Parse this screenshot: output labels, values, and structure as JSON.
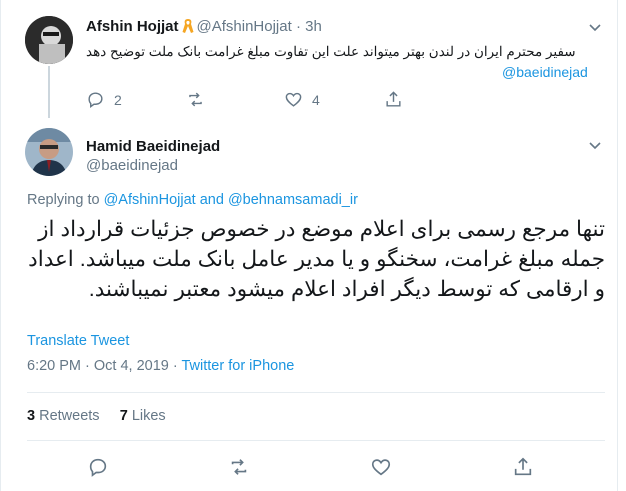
{
  "parent_tweet": {
    "author_name": "Afshin Hojjat",
    "author_handle": "@AfshinHojjat",
    "separator": "·",
    "time": "3h",
    "text": "سفیر محترم ایران در لندن بهتر میتواند علت این تفاوت مبلغ غرامت بانک ملت توضیح دهد",
    "mention": "@baeidinejad",
    "reply_count": "2",
    "like_count": "4"
  },
  "main_tweet": {
    "author_name": "Hamid Baeidinejad",
    "author_handle": "@baeidinejad",
    "replying_prefix": "Replying to",
    "replying_user_1": "@AfshinHojjat",
    "replying_and": "and",
    "replying_user_2": "@behnamsamadi_ir",
    "text": "تنها مرجع رسمی برای اعلام موضع در خصوص جزئیات قرارداد از جمله مبلغ غرامت، سخنگو و یا مدیر عامل بانک ملت میباشد. اعداد و ارقامی که توسط دیگر افراد اعلام میشود معتبر نمیباشند.",
    "translate_label": "Translate Tweet",
    "timestamp": "6:20 PM · Oct 4, 2019 ·",
    "source": "Twitter for iPhone",
    "retweets_count": "3",
    "retweets_label": "Retweets",
    "likes_count": "7",
    "likes_label": "Likes"
  },
  "colors": {
    "link": "#1b95e0",
    "secondary": "#657786",
    "primary_text": "#14171a",
    "divider": "#e6ecf0",
    "ribbon": "#f5a623"
  }
}
